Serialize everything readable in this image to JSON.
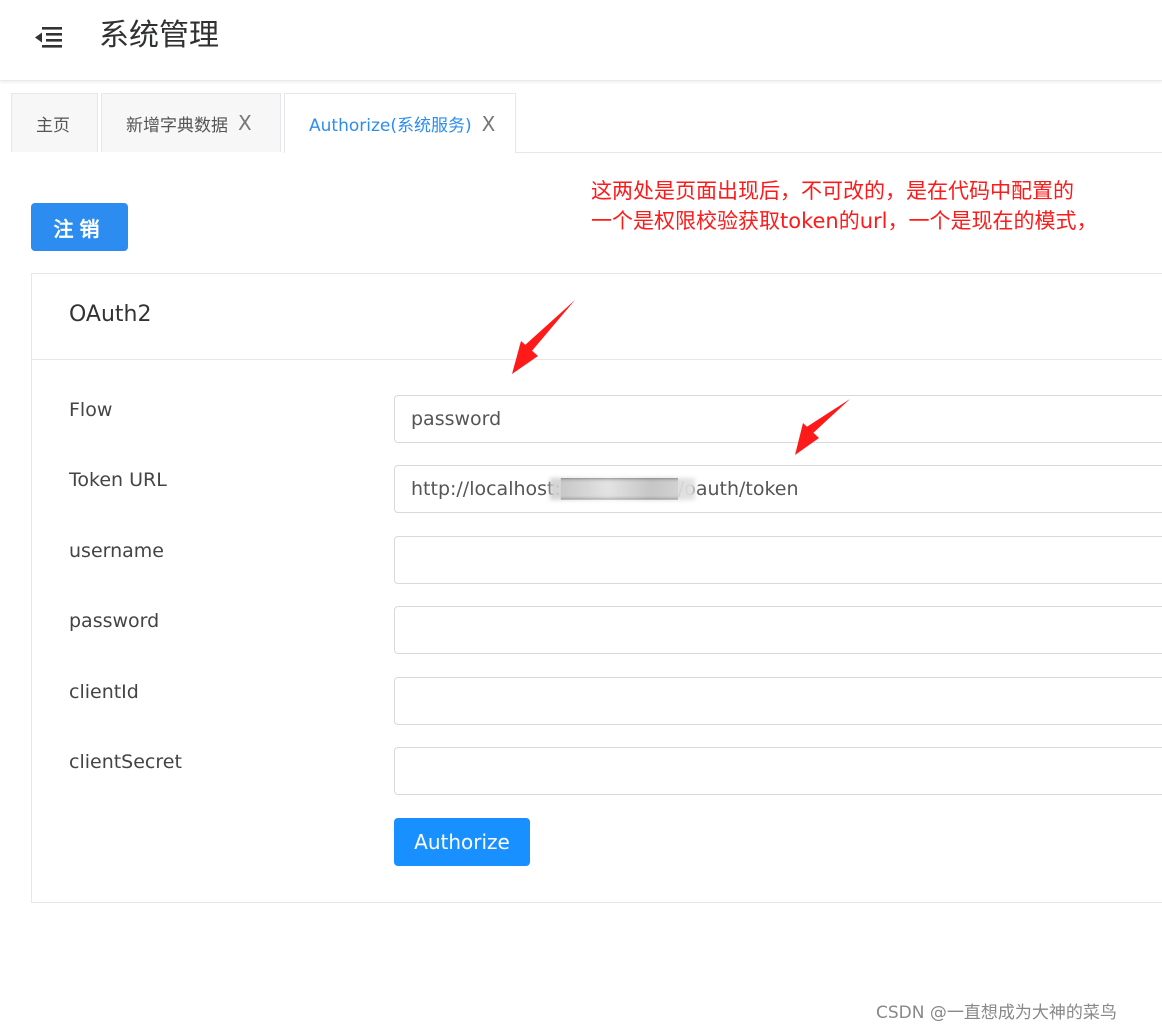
{
  "header": {
    "title": "系统管理"
  },
  "tabs": [
    {
      "label": "主页",
      "closable": false,
      "active": false
    },
    {
      "label": "新增字典数据",
      "closable": true,
      "active": false
    },
    {
      "label": "Authorize(系统服务)",
      "closable": true,
      "active": true
    }
  ],
  "close_glyph": "X",
  "logout_label": "注销",
  "annotation": {
    "line1": "这两处是页面出现后，不可改的，是在代码中配置的",
    "line2": "一个是权限校验获取token的url，一个是现在的模式，"
  },
  "card": {
    "title": "OAuth2",
    "fields": [
      {
        "label": "Flow",
        "value": ""
      },
      {
        "label": "Token URL",
        "value": ""
      },
      {
        "label": "username",
        "value": ""
      },
      {
        "label": "password",
        "value": ""
      },
      {
        "label": "clientId",
        "value": ""
      },
      {
        "label": "clientSecret",
        "value": ""
      }
    ],
    "flow_value": "password",
    "token_url_value": "http://localhost:████████/oauth/token",
    "authorize_label": "Authorize"
  },
  "watermark": "CSDN @一直想成为大神的菜鸟",
  "colors": {
    "primary": "#2d8cf0",
    "annotation": "#ff1a1a"
  }
}
